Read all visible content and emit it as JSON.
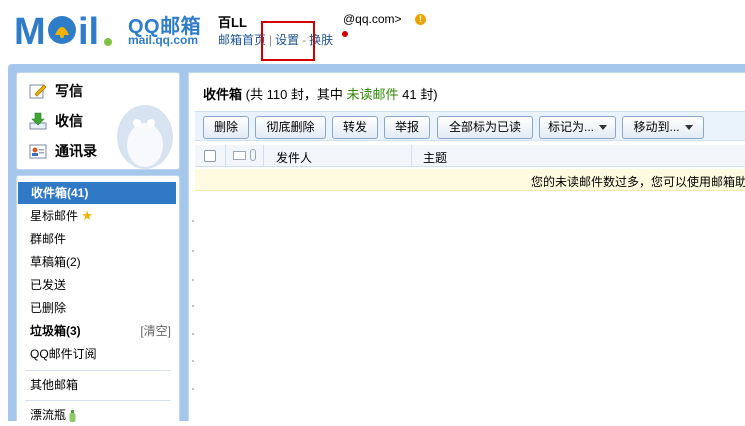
{
  "header": {
    "logo_text": "QQ邮箱",
    "logo_sub": "mail.qq.com",
    "user_name": "百LL",
    "user_email": "@qq.com>",
    "warning_glyph": "!",
    "links": [
      "邮箱首页",
      "设置",
      "换肤"
    ],
    "link_separators": [
      "|",
      "-"
    ]
  },
  "sidebar": {
    "actions": [
      {
        "label": "写信",
        "icon": "pencil-icon"
      },
      {
        "label": "收信",
        "icon": "download-icon"
      },
      {
        "label": "通讯录",
        "icon": "contacts-icon"
      }
    ],
    "folders": [
      {
        "label": "收件箱(41)",
        "active": true
      },
      {
        "label": "星标邮件",
        "icon": "star-icon"
      },
      {
        "label": "群邮件"
      },
      {
        "label": "草稿箱(2)"
      },
      {
        "label": "已发送"
      },
      {
        "label": "已删除"
      },
      {
        "label": "垃圾箱(3)",
        "bold": true,
        "extra": "[清空]"
      },
      {
        "label": "QQ邮件订阅"
      }
    ],
    "other_folders": [
      {
        "label": "其他邮箱"
      },
      {
        "label": "漂流瓶",
        "icon": "bottle-icon"
      }
    ]
  },
  "main": {
    "title": "收件箱",
    "summary_prefix": " (共 110 封，其中 ",
    "unread_label": "未读邮件",
    "summary_suffix": " 41 封)",
    "toolbar": [
      {
        "label": "删除"
      },
      {
        "label": "彻底删除"
      },
      {
        "label": "转发"
      },
      {
        "label": "举报"
      },
      {
        "label": "全部标为已读"
      },
      {
        "label": "标记为...",
        "dropdown": true
      },
      {
        "label": "移动到...",
        "dropdown": true
      }
    ],
    "columns": {
      "sender": "发件人",
      "subject": "主题"
    },
    "notice": "您的未读邮件数过多，您可以使用邮箱助"
  },
  "colors": {
    "brand_blue": "#2f7cc8",
    "active_folder": "#2f79c7",
    "unread_green": "#2d8a00",
    "highlight_red": "#d40000",
    "warning_orange": "#f2a200"
  }
}
